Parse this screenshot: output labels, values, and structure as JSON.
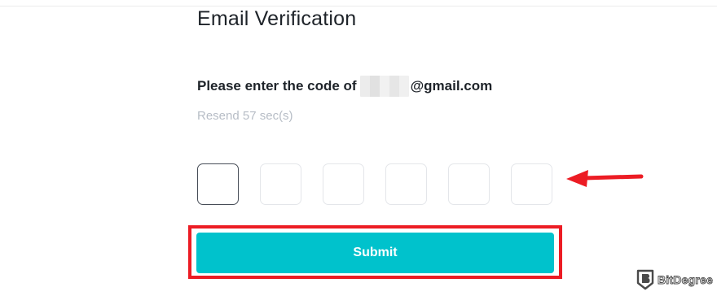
{
  "page": {
    "title": "Email Verification",
    "prompt_prefix": "Please enter the code of",
    "email_suffix": "@gmail.com",
    "resend_text": "Resend 57 sec(s)"
  },
  "code_inputs": {
    "count": 6,
    "values": [
      "",
      "",
      "",
      "",
      "",
      ""
    ],
    "active_index": 0
  },
  "submit": {
    "label": "Submit"
  },
  "watermark": {
    "text": "BitDegree",
    "icon": "bitdegree-shield-icon"
  },
  "annotations": {
    "arrow_icon": "left-arrow-icon",
    "highlight_frame": "red-highlight-frame"
  },
  "colors": {
    "accent": "#00c2cc",
    "highlight": "#ec1c24",
    "text": "#1e2329",
    "muted": "#b7bdc6"
  }
}
